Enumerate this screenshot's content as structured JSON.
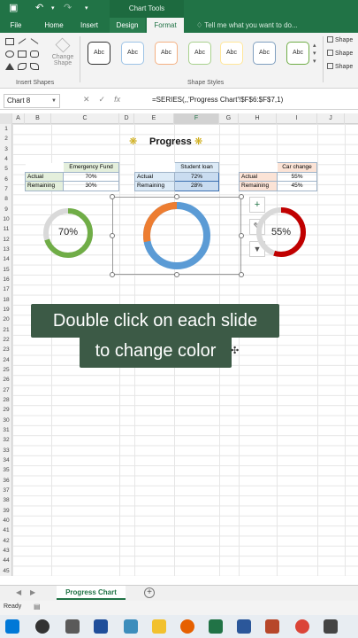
{
  "titlebar": {
    "context_label": "Chart Tools"
  },
  "tabs": [
    {
      "label": "File"
    },
    {
      "label": "Home"
    },
    {
      "label": "Insert"
    },
    {
      "label": "Design"
    },
    {
      "label": "Format"
    }
  ],
  "tell_me": "Tell me what you want to do...",
  "ribbon": {
    "change_shape": "Change Shape",
    "insert_shapes_label": "Insert Shapes",
    "shape_styles_label": "Shape Styles",
    "style_label": "Abc",
    "side_items": [
      "Shape",
      "Shape",
      "Shape"
    ],
    "style_colors": [
      "#333333",
      "#9dc3e6",
      "#f4b183",
      "#a9d18e",
      "#ffe699",
      "#7f9fbf",
      "#70ad47"
    ]
  },
  "formula_bar": {
    "name_box": "Chart 8",
    "cancel": "✕",
    "enter": "✓",
    "fx": "fx",
    "formula": "=SERIES(,,'Progress Chart'!$F$6:$F$7,1)"
  },
  "columns": [
    "A",
    "B",
    "C",
    "D",
    "E",
    "F",
    "G",
    "H",
    "I",
    "J"
  ],
  "rows": [
    "1",
    "2",
    "3",
    "4",
    "5",
    "6",
    "7",
    "8",
    "9",
    "10",
    "11",
    "12",
    "13",
    "14",
    "15",
    "16",
    "17",
    "18",
    "19",
    "20",
    "21",
    "22",
    "23",
    "24",
    "25",
    "26",
    "27",
    "28",
    "29",
    "30",
    "31",
    "32",
    "33",
    "34",
    "35",
    "36",
    "37",
    "38",
    "39",
    "40",
    "41",
    "42",
    "43",
    "44",
    "45"
  ],
  "sheet": {
    "title": "Progress",
    "tables": [
      {
        "header": "Emergency Fund",
        "rows": [
          {
            "label": "Actual",
            "value": "70%"
          },
          {
            "label": "Remaining",
            "value": "30%"
          }
        ]
      },
      {
        "header": "Student loan",
        "rows": [
          {
            "label": "Actual",
            "value": "72%"
          },
          {
            "label": "Remaining",
            "value": "28%"
          }
        ]
      },
      {
        "header": "Car change",
        "rows": [
          {
            "label": "Actual",
            "value": "55%"
          },
          {
            "label": "Remaining",
            "value": "45%"
          }
        ]
      }
    ]
  },
  "charts": [
    {
      "label": "70%",
      "actual": 0.7,
      "color": "#70ad47"
    },
    {
      "label": "",
      "actual": 0.28,
      "color": "#ed7d31",
      "rest_color": "#5b9bd5"
    },
    {
      "label": "55%",
      "actual": 0.55,
      "color": "#c00000"
    }
  ],
  "chart_buttons": {
    "add": "+",
    "style": "✎",
    "filter": "▼"
  },
  "caption": {
    "line1": "Double click on each slide",
    "line2": "to change color"
  },
  "sheet_tab": "Progress Chart",
  "add_sheet": "+",
  "status": "Ready"
}
